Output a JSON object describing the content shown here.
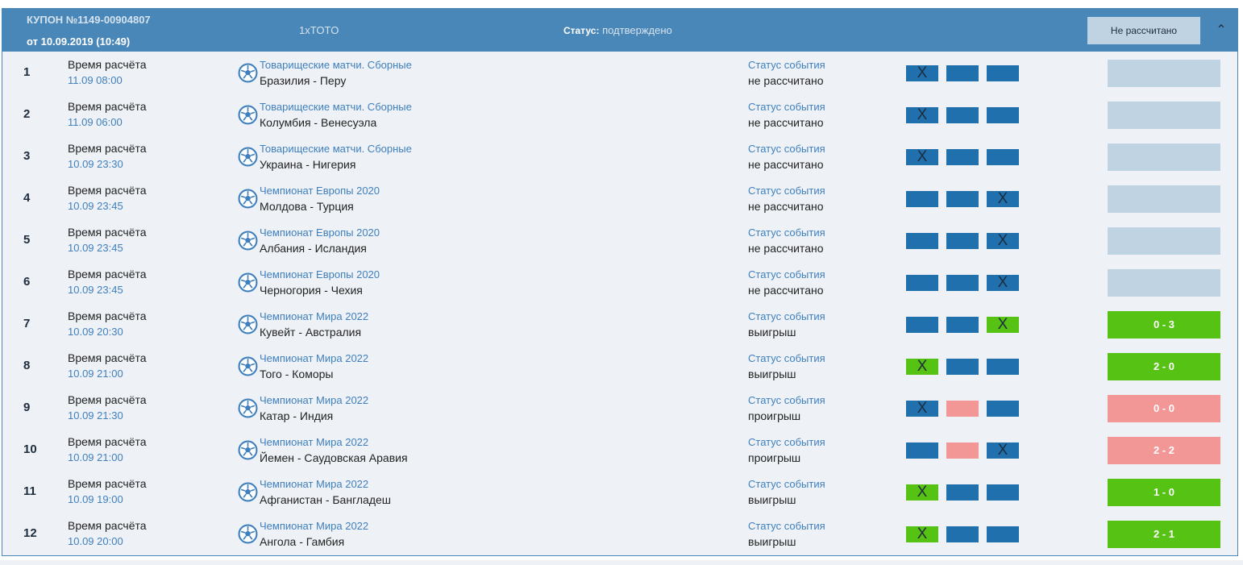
{
  "header": {
    "coupon_number": "КУПОН №1149-00904807",
    "date": "от 10.09.2019 (10:49)",
    "type": "1xTOTO",
    "status_label": "Статус:",
    "status_value": "подтверждено",
    "button": "Не рассчитано"
  },
  "time_label": "Время расчёта",
  "status_label": "Статус события",
  "colors": {
    "header": "#4a87b9",
    "blue": "#2070ae",
    "green": "#56c214",
    "red": "#f39696",
    "pending": "#c0d3e2"
  },
  "rows": [
    {
      "n": "1",
      "time": "11.09 08:00",
      "league": "Товарищеские матчи. Сборные",
      "match": "Бразилия - Перу",
      "status": "не рассчитано",
      "boxes": [
        "blue",
        "blue",
        "blue"
      ],
      "pick": 0,
      "result": "",
      "rstate": "none"
    },
    {
      "n": "2",
      "time": "11.09 06:00",
      "league": "Товарищеские матчи. Сборные",
      "match": "Колумбия - Венесуэла",
      "status": "не рассчитано",
      "boxes": [
        "blue",
        "blue",
        "blue"
      ],
      "pick": 0,
      "result": "",
      "rstate": "none"
    },
    {
      "n": "3",
      "time": "10.09 23:30",
      "league": "Товарищеские матчи. Сборные",
      "match": "Украина - Нигерия",
      "status": "не рассчитано",
      "boxes": [
        "blue",
        "blue",
        "blue"
      ],
      "pick": 0,
      "result": "",
      "rstate": "none"
    },
    {
      "n": "4",
      "time": "10.09 23:45",
      "league": "Чемпионат Европы 2020",
      "match": "Молдова - Турция",
      "status": "не рассчитано",
      "boxes": [
        "blue",
        "blue",
        "blue"
      ],
      "pick": 2,
      "result": "",
      "rstate": "none"
    },
    {
      "n": "5",
      "time": "10.09 23:45",
      "league": "Чемпионат Европы 2020",
      "match": "Албания - Исландия",
      "status": "не рассчитано",
      "boxes": [
        "blue",
        "blue",
        "blue"
      ],
      "pick": 2,
      "result": "",
      "rstate": "none"
    },
    {
      "n": "6",
      "time": "10.09 23:45",
      "league": "Чемпионат Европы 2020",
      "match": "Черногория - Чехия",
      "status": "не рассчитано",
      "boxes": [
        "blue",
        "blue",
        "blue"
      ],
      "pick": 2,
      "result": "",
      "rstate": "none"
    },
    {
      "n": "7",
      "time": "10.09 20:30",
      "league": "Чемпионат Мира 2022",
      "match": "Кувейт - Австралия",
      "status": "выигрыш",
      "boxes": [
        "blue",
        "blue",
        "green"
      ],
      "pick": 2,
      "result": "0 - 3",
      "rstate": "green"
    },
    {
      "n": "8",
      "time": "10.09 21:00",
      "league": "Чемпионат Мира 2022",
      "match": "Того - Коморы",
      "status": "выигрыш",
      "boxes": [
        "green",
        "blue",
        "blue"
      ],
      "pick": 0,
      "result": "2 - 0",
      "rstate": "green"
    },
    {
      "n": "9",
      "time": "10.09 21:30",
      "league": "Чемпионат Мира 2022",
      "match": "Катар - Индия",
      "status": "проигрыш",
      "boxes": [
        "blue",
        "red",
        "blue"
      ],
      "pick": 0,
      "result": "0 - 0",
      "rstate": "red"
    },
    {
      "n": "10",
      "time": "10.09 21:00",
      "league": "Чемпионат Мира 2022",
      "match": "Йемен - Саудовская Аравия",
      "status": "проигрыш",
      "boxes": [
        "blue",
        "red",
        "blue"
      ],
      "pick": 2,
      "result": "2 - 2",
      "rstate": "red"
    },
    {
      "n": "11",
      "time": "10.09 19:00",
      "league": "Чемпионат Мира 2022",
      "match": "Афганистан - Бангладеш",
      "status": "выигрыш",
      "boxes": [
        "green",
        "blue",
        "blue"
      ],
      "pick": 0,
      "result": "1 - 0",
      "rstate": "green"
    },
    {
      "n": "12",
      "time": "10.09 20:00",
      "league": "Чемпионат Мира 2022",
      "match": "Ангола - Гамбия",
      "status": "выигрыш",
      "boxes": [
        "green",
        "blue",
        "blue"
      ],
      "pick": 0,
      "result": "2 - 1",
      "rstate": "green"
    }
  ],
  "pick_mark": "X"
}
